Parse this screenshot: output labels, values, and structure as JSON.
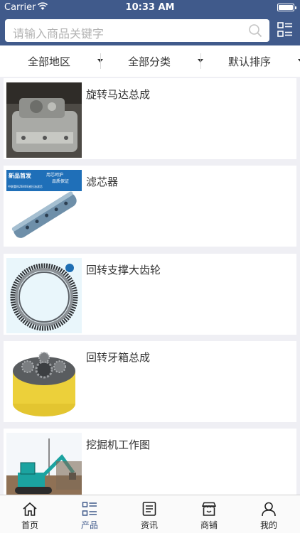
{
  "status_bar": {
    "carrier": "Carrier",
    "time": "10:33 AM"
  },
  "search": {
    "placeholder": "请输入商品关键字"
  },
  "filters": [
    {
      "label": "全部地区"
    },
    {
      "label": "全部分类"
    },
    {
      "label": "默认排序"
    }
  ],
  "products": [
    {
      "name": "旋转马达总成"
    },
    {
      "name": "滤芯器",
      "image_text_1": "新品首发",
      "image_text_2": "用芯呵护",
      "image_text_3": "品质保证",
      "image_text_4": "中联重科ZE80E液压油滤芯"
    },
    {
      "name": "回转支撑大齿轮"
    },
    {
      "name": "回转牙箱总成"
    },
    {
      "name": "挖掘机工作图"
    }
  ],
  "tabs": [
    {
      "label": "首页",
      "icon": "home-icon",
      "active": false
    },
    {
      "label": "产品",
      "icon": "list-icon",
      "active": true
    },
    {
      "label": "资讯",
      "icon": "news-icon",
      "active": false
    },
    {
      "label": "商铺",
      "icon": "shop-icon",
      "active": false
    },
    {
      "label": "我的",
      "icon": "user-icon",
      "active": false
    }
  ],
  "colors": {
    "primary": "#405a8b",
    "background": "#efeff4",
    "text": "#333333"
  }
}
